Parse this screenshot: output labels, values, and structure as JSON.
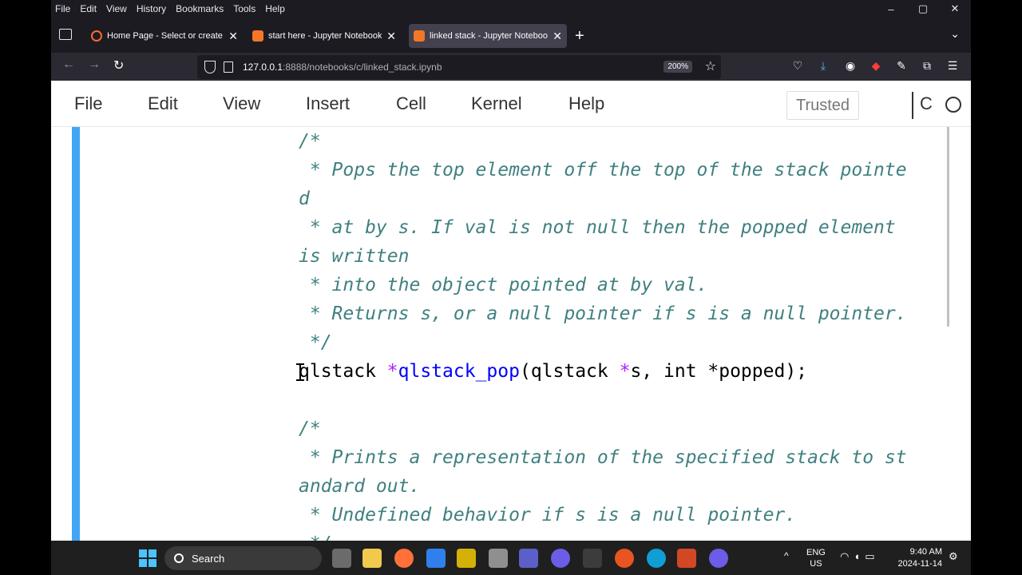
{
  "browser": {
    "menu": [
      "File",
      "Edit",
      "View",
      "History",
      "Bookmarks",
      "Tools",
      "Help"
    ],
    "window_controls": [
      "–",
      "▢",
      "✕"
    ],
    "tabs": [
      {
        "label": "Home Page - Select or create a"
      },
      {
        "label": "start here - Jupyter Notebook"
      },
      {
        "label": "linked stack - Jupyter Noteboo"
      }
    ],
    "new_tab": "+",
    "tab_list": "⌄",
    "url_host": "127.0.0.1",
    "url_path": ":8888/notebooks/c/linked_stack.ipynb",
    "zoom": "200%"
  },
  "jupyter": {
    "menu": [
      "File",
      "Edit",
      "View",
      "Insert",
      "Cell",
      "Kernel",
      "Help"
    ],
    "trusted": "Trusted",
    "kernel_name": "C"
  },
  "code": {
    "lines": [
      {
        "kind": "comment",
        "text": "/*"
      },
      {
        "kind": "comment",
        "text": " * Pops the top element off the top of the stack pointe"
      },
      {
        "kind": "comment",
        "text": "d"
      },
      {
        "kind": "comment",
        "text": " * at by s. If val is not null then the popped element"
      },
      {
        "kind": "comment",
        "text": "is written"
      },
      {
        "kind": "comment",
        "text": " * into the object pointed at by val."
      },
      {
        "kind": "comment",
        "text": " * Returns s, or a null pointer if s is a null pointer."
      },
      {
        "kind": "comment",
        "text": " */"
      },
      {
        "kind": "decl",
        "parts": [
          {
            "c": "ty",
            "t": "qlstack "
          },
          {
            "c": "op",
            "t": "*"
          },
          {
            "c": "fn",
            "t": "qlstack_pop"
          },
          {
            "c": "ty",
            "t": "(qlstack "
          },
          {
            "c": "op",
            "t": "*"
          },
          {
            "c": "ty",
            "t": "s, int *popped);"
          }
        ]
      },
      {
        "kind": "blank",
        "text": ""
      },
      {
        "kind": "comment",
        "text": "/*"
      },
      {
        "kind": "comment",
        "text": " * Prints a representation of the specified stack to st"
      },
      {
        "kind": "comment",
        "text": "andard out."
      },
      {
        "kind": "comment",
        "text": " * Undefined behavior if s is a null pointer."
      },
      {
        "kind": "comment",
        "text": " */"
      }
    ]
  },
  "taskbar": {
    "search_label": "Search",
    "language": "ENG",
    "region": "US",
    "time": "9:40 AM",
    "date": "2024-11-14"
  },
  "colors": {
    "cell_bar": "#42a5f5",
    "comment": "#408080",
    "operator": "#aa22ff",
    "function": "#0000ff"
  }
}
